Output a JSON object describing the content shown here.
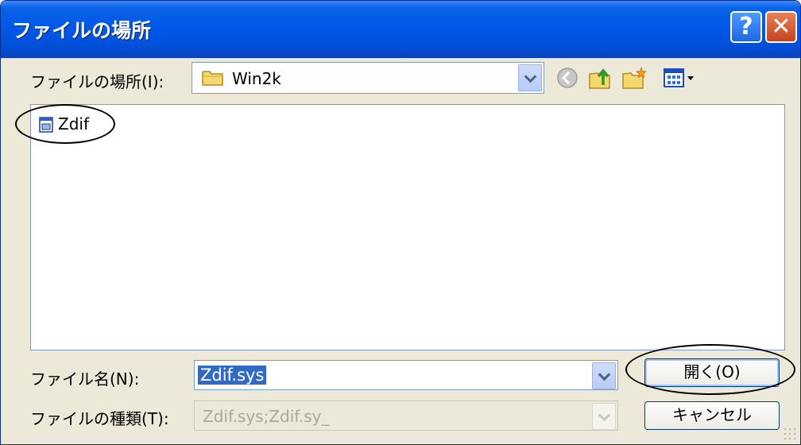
{
  "window": {
    "title": "ファイルの場所",
    "help_label": "?",
    "close_label": "✕"
  },
  "lookin": {
    "label": "ファイルの場所(I):",
    "value": "Win2k"
  },
  "toolbar": {
    "icons": [
      "back-icon",
      "up-folder-icon",
      "new-folder-icon",
      "view-menu-icon"
    ]
  },
  "files": [
    {
      "name": "Zdif",
      "icon": "system-file-icon"
    }
  ],
  "filename": {
    "label": "ファイル名(N):",
    "value": "Zdif.sys"
  },
  "filetype": {
    "label": "ファイルの種類(T):",
    "value": "Zdif.sys;Zdif.sy_"
  },
  "buttons": {
    "open": "開く(O)",
    "cancel": "キャンセル"
  },
  "colors": {
    "title_bar": "#0058e8",
    "selection": "#316ac5",
    "dialog_bg": "#ece9d8"
  }
}
